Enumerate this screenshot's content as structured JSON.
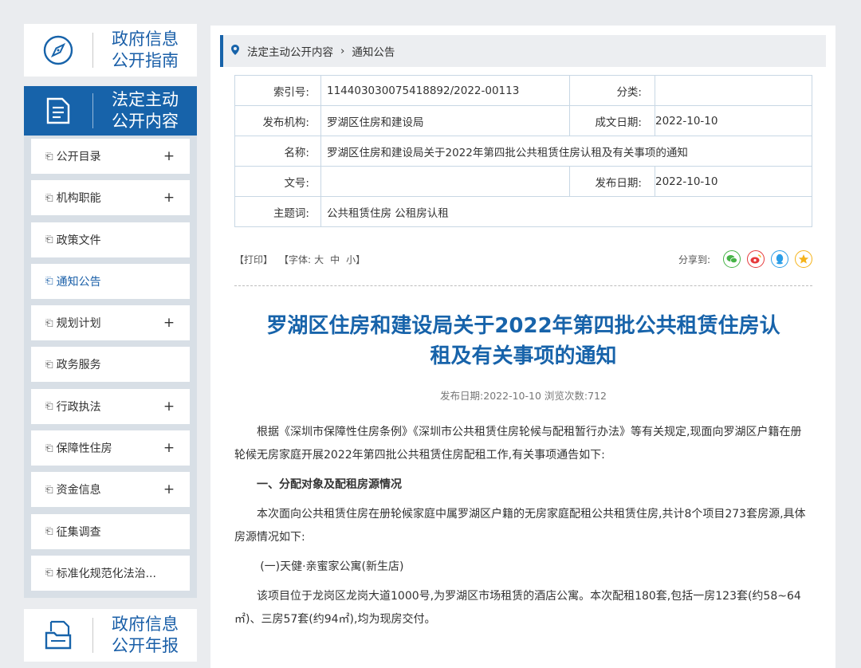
{
  "sidebar": {
    "guide_title_1": "政府信息",
    "guide_title_2": "公开指南",
    "statutory_title_1": "法定主动",
    "statutory_title_2": "公开内容",
    "report_title_1": "政府信息",
    "report_title_2": "公开年报",
    "items": [
      {
        "label": "公开目录",
        "plus": "+"
      },
      {
        "label": "机构职能",
        "plus": "+"
      },
      {
        "label": "政策文件",
        "plus": ""
      },
      {
        "label": "通知公告",
        "plus": ""
      },
      {
        "label": "规划计划",
        "plus": "+"
      },
      {
        "label": "政务服务",
        "plus": ""
      },
      {
        "label": "行政执法",
        "plus": "+"
      },
      {
        "label": "保障性住房",
        "plus": "+"
      },
      {
        "label": "资金信息",
        "plus": "+"
      },
      {
        "label": "征集调查",
        "plus": ""
      },
      {
        "label": "标准化规范化法治...",
        "plus": ""
      }
    ],
    "active_index": 3
  },
  "breadcrumb": {
    "first": "法定主动公开内容",
    "sep": "›",
    "second": "通知公告"
  },
  "meta": {
    "index_label": "索引号:",
    "index_value": "11440303007541 8892/2022-00113",
    "category_label": "分类:",
    "category_value": "",
    "issuer_label": "发布机构:",
    "issuer_value": "罗湖区住房和建设局",
    "created_label": "成文日期:",
    "created_value": "2022-10-10",
    "name_label": "名称:",
    "name_value": "罗湖区住房和建设局关于2022年第四批公共租赁住房认租及有关事项的通知",
    "docno_label": "文号:",
    "docno_value": "",
    "published_label": "发布日期:",
    "published_value": "2022-10-10",
    "keywords_label": "主题词:",
    "keywords_value": "公共租赁住房 公租房认租"
  },
  "tools": {
    "print": "【打印】",
    "font_prefix": "【字体:",
    "font_large": "大",
    "font_medium": "中",
    "font_small": "小】",
    "share_label": "分享到:"
  },
  "article": {
    "title": "罗湖区住房和建设局关于2022年第四批公共租赁住房认租及有关事项的通知",
    "pubinfo": "发布日期:2022-10-10  浏览次数:712",
    "p1": "根据《深圳市保障性住房条例》《深圳市公共租赁住房轮候与配租暂行办法》等有关规定,现面向罗湖区户籍在册轮候无房家庭开展2022年第四批公共租赁住房配租工作,有关事项通告如下:",
    "h1": "一、分配对象及配租房源情况",
    "p2": "本次面向公共租赁住房在册轮候家庭中属罗湖区户籍的无房家庭配租公共租赁住房,共计8个项目273套房源,具体房源情况如下:",
    "sub1": "(一)天健·亲蜜家公寓(新生店)",
    "p3": "该项目位于龙岗区龙岗大道1000号,为罗湖区市场租赁的酒店公寓。本次配租180套,包括一房123套(约58~64㎡)、三房57套(约94㎡),均为现房交付。"
  },
  "colors": {
    "brand_blue": "#1763aa",
    "wechat": "#46b347",
    "weibo": "#e6393b",
    "qq": "#2b9ee8",
    "qzone": "#f5b31a"
  }
}
